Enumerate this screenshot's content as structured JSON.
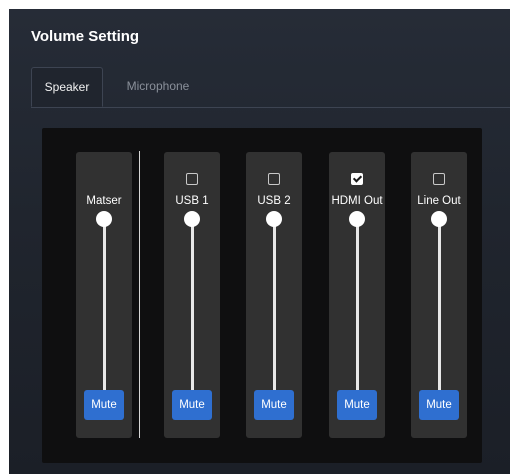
{
  "panel": {
    "title": "Volume Setting"
  },
  "tabs": [
    {
      "label": "Speaker",
      "active": true
    },
    {
      "label": "Microphone",
      "active": false
    }
  ],
  "colors": {
    "accent": "#2f6fd0",
    "panel_bg": "#20252e",
    "mixer_bg": "#0f0f10",
    "channel_bg": "#313131"
  },
  "channels": [
    {
      "label": "Matser",
      "has_checkbox": false,
      "checked": false,
      "volume_percent": 100,
      "mute_label": "Mute"
    },
    {
      "label": "USB 1",
      "has_checkbox": true,
      "checked": false,
      "volume_percent": 100,
      "mute_label": "Mute"
    },
    {
      "label": "USB 2",
      "has_checkbox": true,
      "checked": false,
      "volume_percent": 100,
      "mute_label": "Mute"
    },
    {
      "label": "HDMI Out",
      "has_checkbox": true,
      "checked": true,
      "volume_percent": 100,
      "mute_label": "Mute"
    },
    {
      "label": "Line Out",
      "has_checkbox": true,
      "checked": false,
      "volume_percent": 100,
      "mute_label": "Mute"
    }
  ]
}
